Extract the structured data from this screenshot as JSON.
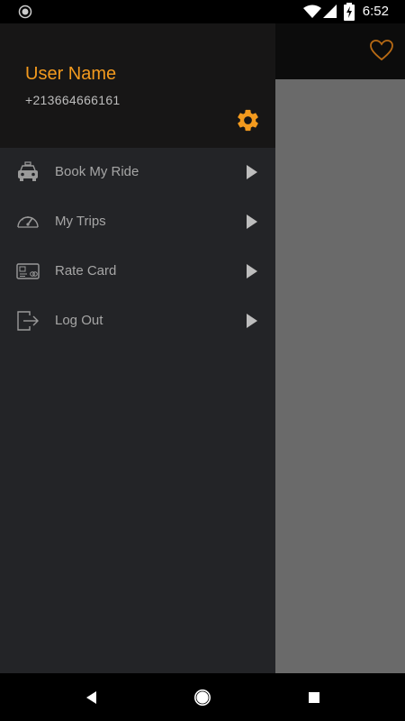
{
  "status_bar": {
    "time": "6:52",
    "icons": [
      "record-icon",
      "wifi-icon",
      "signal-icon",
      "battery-charging-icon"
    ]
  },
  "drawer": {
    "user_name": "User Name",
    "phone": "+213664666161",
    "settings_icon": "gear-icon",
    "items": [
      {
        "label": "Book My Ride",
        "icon": "taxi-icon"
      },
      {
        "label": "My Trips",
        "icon": "speedometer-icon"
      },
      {
        "label": "Rate Card",
        "icon": "rate-card-icon"
      },
      {
        "label": "Log Out",
        "icon": "logout-icon"
      }
    ]
  },
  "toolbar": {
    "action_icon": "heart-icon"
  },
  "nav_bar": {
    "buttons": [
      "back-button",
      "home-button",
      "recents-button"
    ]
  },
  "colors": {
    "accent": "#F39A1E",
    "drawer_bg": "#232427",
    "header_bg": "#171616",
    "scrim": "#6A6A6A",
    "text_muted": "#A6A6A6"
  }
}
